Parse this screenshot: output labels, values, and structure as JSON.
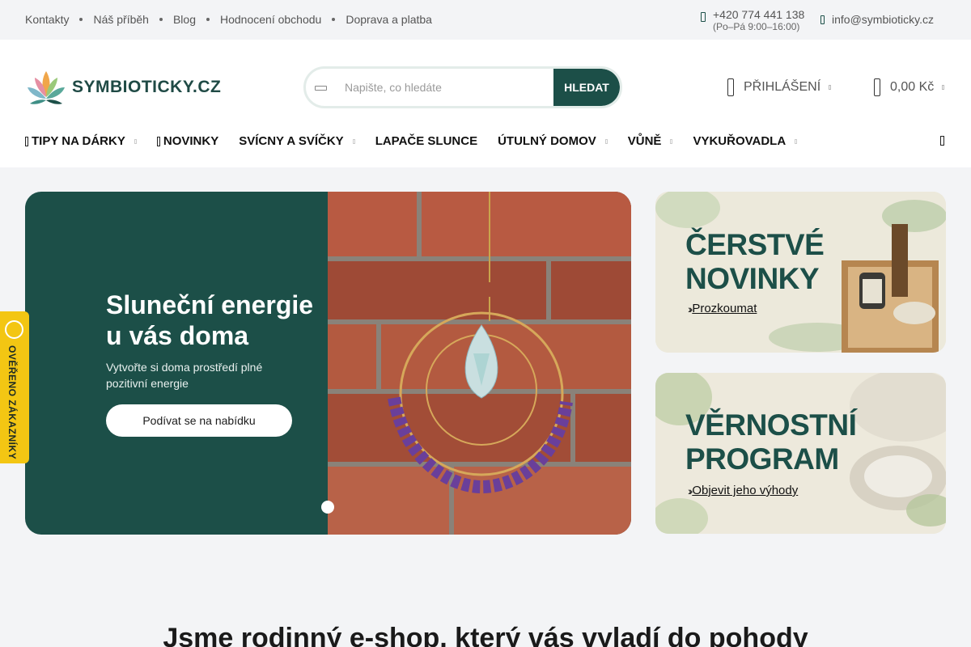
{
  "topbar": {
    "links": [
      "Kontakty",
      "Náš příběh",
      "Blog",
      "Hodnocení obchodu",
      "Doprava a platba"
    ],
    "phone": "+420 774 441 138",
    "hours": "(Po–Pá 9:00–16:00)",
    "email": "info@symbioticky.cz"
  },
  "header": {
    "logo_text": "SYMBIOTICKY.CZ",
    "search_placeholder": "Napište, co hledáte",
    "search_button": "HLEDAT",
    "login_label": "PŘIHLÁŠENÍ",
    "cart_label": "0,00 Kč"
  },
  "nav": {
    "items": [
      "TIPY NA DÁRKY",
      "NOVINKY",
      "SVÍCNY A SVÍČKY",
      "LAPAČE SLUNCE",
      "ÚTULNÝ DOMOV",
      "VŮNĚ",
      "VYKUŘOVADLA"
    ]
  },
  "hero": {
    "title": "Sluneční energie u vás doma",
    "subtitle": "Vytvořte si doma prostředí plné pozitivní energie",
    "button": "Podívat se na nabídku"
  },
  "promos": [
    {
      "title_line1": "ČERSTVÉ",
      "title_line2": "NOVINKY",
      "link": "Prozkoumat"
    },
    {
      "title_line1": "VĚRNOSTNÍ",
      "title_line2": "PROGRAM",
      "link": "Objevit jeho výhody"
    }
  ],
  "badge": {
    "text": "OVĚŘENO ZÁKAZNÍKY"
  },
  "headline": "Jsme rodinný e-shop, který vás vyladí do pohody",
  "colors": {
    "brand": "#1c4f48",
    "badge": "#f3c613",
    "topbar": "#f3f4f6"
  }
}
